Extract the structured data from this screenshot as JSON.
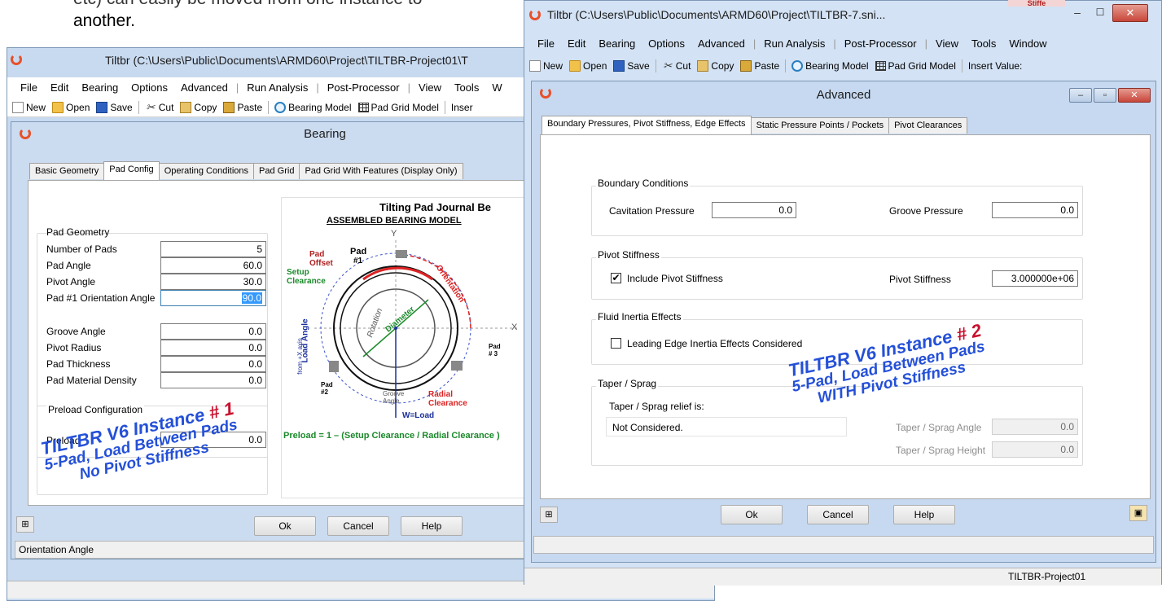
{
  "document": {
    "line_faded": "etc) can easily be moved from one instance to",
    "line_2": "another."
  },
  "window1": {
    "title": "Tiltbr (C:\\Users\\Public\\Documents\\ARMD60\\Project\\TILTBR-Project01\\T",
    "menu": [
      "File",
      "Edit",
      "Bearing",
      "Options",
      "Advanced",
      "Run Analysis",
      "Post-Processor",
      "View",
      "Tools",
      "W"
    ],
    "toolbar": {
      "new": "New",
      "open": "Open",
      "save": "Save",
      "cut": "Cut",
      "copy": "Copy",
      "paste": "Paste",
      "bearing_model": "Bearing Model",
      "pad_grid_model": "Pad Grid Model",
      "insert": "Inser"
    },
    "status": "Orientation Angle"
  },
  "bearing_dialog": {
    "title": "Bearing",
    "tabs": [
      "Basic Geometry",
      "Pad Config",
      "Operating Conditions",
      "Pad Grid",
      "Pad Grid With Features (Display Only)"
    ],
    "active_tab": "Pad Config",
    "pad_geometry": {
      "label": "Pad Geometry",
      "fields": [
        {
          "label": "Number of Pads",
          "value": "5"
        },
        {
          "label": "Pad Angle",
          "value": "60.0"
        },
        {
          "label": "Pivot Angle",
          "value": "30.0"
        },
        {
          "label": "Pad #1 Orientation Angle",
          "value": "90.0"
        }
      ],
      "fields2": [
        {
          "label": "Groove Angle",
          "value": "0.0"
        },
        {
          "label": "Pivot Radius",
          "value": "0.0"
        },
        {
          "label": "Pad Thickness",
          "value": "0.0"
        },
        {
          "label": "Pad Material Density",
          "value": "0.0"
        }
      ]
    },
    "preload": {
      "label": "Preload Configuration",
      "field_label": "Preload",
      "value": "0.0"
    },
    "diagram": {
      "title": "Tilting Pad Journal Be",
      "subtitle": "ASSEMBLED BEARING MODEL",
      "labels": {
        "pad": "Pad",
        "pad1": "#1",
        "pad_offset": "Pad Offset",
        "setup_clearance": "Setup Clearance",
        "orientation": "Orientation",
        "rotation": "Rotation",
        "diameter": "Diameter",
        "load_angle": "Load Angle",
        "from_x": "from +X axis",
        "pad2": "Pad #2",
        "pad3": "Pad # 3",
        "groove_angle": "Groove Angle",
        "radial_clearance": "Radial Clearance",
        "w_load": "W=Load",
        "y": "Y",
        "x": "X",
        "preload_formula": "Preload = 1 – (Setup Clearance / Radial Clearance )"
      }
    },
    "buttons": {
      "ok": "Ok",
      "cancel": "Cancel",
      "help": "Help"
    }
  },
  "overlay1": {
    "line1_blue": "TILTBR V6 Instance ",
    "line1_red": "# 1",
    "line2": "5-Pad, Load Between Pads",
    "line3": "No Pivot Stiffness"
  },
  "window2": {
    "title": "Tiltbr (C:\\Users\\Public\\Documents\\ARMD60\\Project\\TILTBR-7.sni...",
    "menu": [
      "File",
      "Edit",
      "Bearing",
      "Options",
      "Advanced",
      "Run Analysis",
      "Post-Processor",
      "View",
      "Tools",
      "Window"
    ],
    "toolbar": {
      "new": "New",
      "open": "Open",
      "save": "Save",
      "cut": "Cut",
      "copy": "Copy",
      "paste": "Paste",
      "bearing_model": "Bearing Model",
      "pad_grid_model": "Pad Grid Model",
      "insert": "Insert Value:"
    },
    "status_project": "TILTBR-Project01",
    "right_edge_text": "Stiffe"
  },
  "advanced_dialog": {
    "title": "Advanced",
    "tabs": [
      "Boundary Pressures, Pivot Stiffness, Edge Effects",
      "Static Pressure Points / Pockets",
      "Pivot Clearances"
    ],
    "active_tab": "Boundary Pressures, Pivot Stiffness, Edge Effects",
    "boundary": {
      "label": "Boundary Conditions",
      "cavitation_label": "Cavitation Pressure",
      "cavitation_value": "0.0",
      "groove_label": "Groove Pressure",
      "groove_value": "0.0"
    },
    "pivot": {
      "label": "Pivot Stiffness",
      "include_label": "Include Pivot Stiffness",
      "include_checked": true,
      "stiffness_label": "Pivot Stiffness",
      "stiffness_value": "3.000000e+06"
    },
    "fluid": {
      "label": "Fluid Inertia Effects",
      "leading_label": "Leading Edge Inertia Effects Considered",
      "leading_checked": false
    },
    "taper": {
      "label": "Taper / Sprag",
      "relief_label": "Taper / Sprag relief is:",
      "relief_value": "Not Considered.",
      "angle_label": "Taper / Sprag Angle",
      "angle_value": "0.0",
      "height_label": "Taper / Sprag Height",
      "height_value": "0.0"
    },
    "buttons": {
      "ok": "Ok",
      "cancel": "Cancel",
      "help": "Help"
    }
  },
  "overlay2": {
    "line1_blue": "TILTBR V6 Instance ",
    "line1_red": "# 2",
    "line2": "5-Pad, Load Between Pads",
    "line3": "WITH Pivot Stiffness"
  },
  "colors": {
    "overlay_blue": "#2450d8",
    "overlay_red": "#c8102e",
    "window_frame": "#c8daf0"
  }
}
